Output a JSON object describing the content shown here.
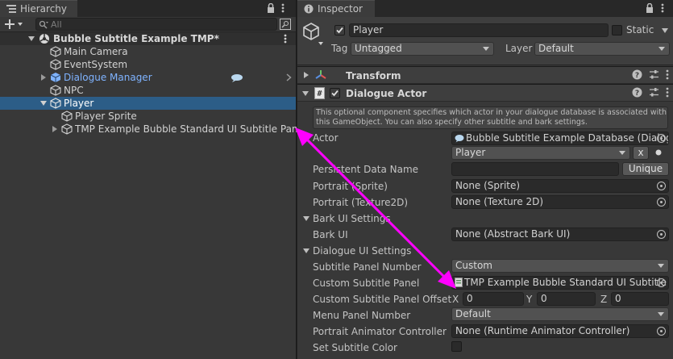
{
  "hierarchy": {
    "tab_label": "Hierarchy",
    "search_placeholder": "All",
    "scene_name": "Bubble Subtitle Example TMP*",
    "items": [
      {
        "label": "Main Camera"
      },
      {
        "label": "EventSystem"
      },
      {
        "label": "Dialogue Manager"
      },
      {
        "label": "NPC"
      },
      {
        "label": "Player"
      },
      {
        "label": "Player Sprite"
      },
      {
        "label": "TMP Example Bubble Standard UI Subtitle Panel"
      }
    ]
  },
  "inspector": {
    "tab_label": "Inspector",
    "object_name": "Player",
    "static_label": "Static",
    "tag_label": "Tag",
    "tag_value": "Untagged",
    "layer_label": "Layer",
    "layer_value": "Default",
    "transform_title": "Transform",
    "component_title": "Dialogue Actor",
    "help_text_line1": "This optional component specifies which actor in your dialogue database is associated with",
    "help_text_line2": "this GameObject. You can also specify other subtitle and bark settings.",
    "fields": {
      "actor_label": "Actor",
      "actor_db_value": "Bubble Subtitle Example Database (Dialog",
      "actor_value": "Player",
      "actor_clear": "x",
      "persistent_label": "Persistent Data Name",
      "persistent_value": "",
      "unique_button": "Unique",
      "portrait_sprite_label": "Portrait (Sprite)",
      "portrait_sprite_value": "None (Sprite)",
      "portrait_tex_label": "Portrait (Texture2D)",
      "portrait_tex_value": "None (Texture 2D)",
      "bark_section": "Bark UI Settings",
      "bark_ui_label": "Bark UI",
      "bark_ui_value": "None (Abstract Bark UI)",
      "dialogue_section": "Dialogue UI Settings",
      "subtitle_number_label": "Subtitle Panel Number",
      "subtitle_number_value": "Custom",
      "custom_panel_label": "Custom Subtitle Panel",
      "custom_panel_value": "TMP Example Bubble Standard UI Subtitle",
      "offset_label": "Custom Subtitle Panel Offset",
      "offset_x_label": "X",
      "offset_x": "0",
      "offset_y_label": "Y",
      "offset_y": "0",
      "offset_z_label": "Z",
      "offset_z": "0",
      "menu_number_label": "Menu Panel Number",
      "menu_number_value": "Default",
      "animator_label": "Portrait Animator Controller",
      "animator_value": "None (Runtime Animator Controller)",
      "set_color_label": "Set Subtitle Color"
    }
  },
  "colors": {
    "selection": "#2c5d87",
    "prefab_blue": "#7fb3ff",
    "annotation_arrow": "#ff00ff"
  }
}
